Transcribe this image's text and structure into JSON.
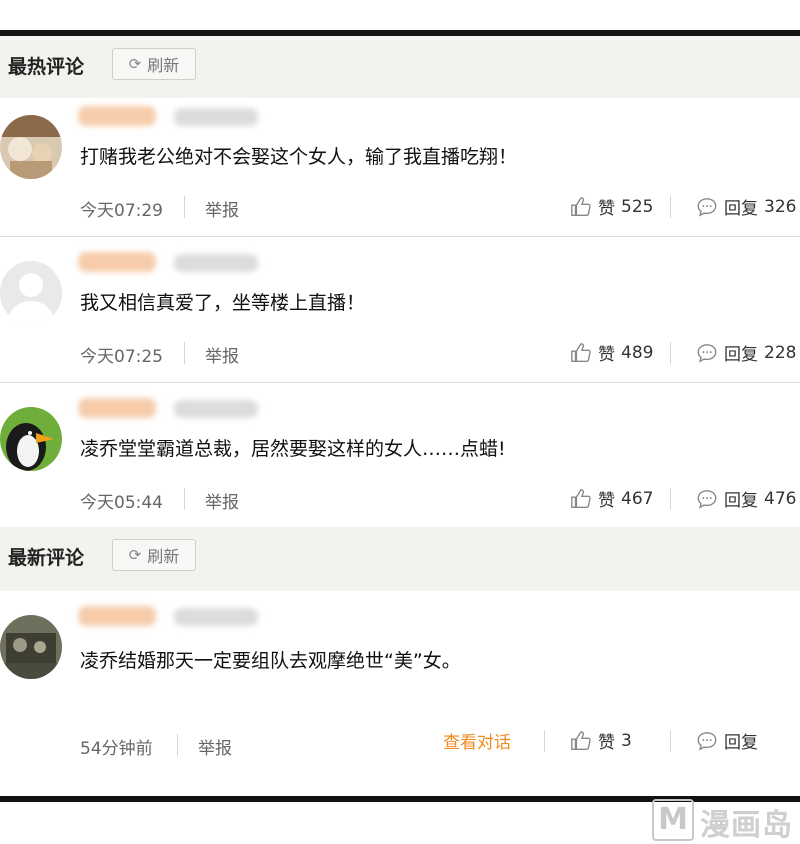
{
  "hot_section": {
    "title": "最热评论",
    "refresh_label": "刷新"
  },
  "new_section": {
    "title": "最新评论",
    "refresh_label": "刷新"
  },
  "hot_comments": [
    {
      "text": "打赌我老公绝对不会娶这个女人，输了我直播吃翔！",
      "time": "今天07:29",
      "report": "举报",
      "like_label": "赞",
      "like_count": "525",
      "reply_label": "回复",
      "reply_count": "326",
      "avatar_icon": "photo-avatar"
    },
    {
      "text": "我又相信真爱了，坐等楼上直播！",
      "time": "今天07:25",
      "report": "举报",
      "like_label": "赞",
      "like_count": "489",
      "reply_label": "回复",
      "reply_count": "228",
      "avatar_icon": "default-user-avatar"
    },
    {
      "text": "凌乔堂堂霸道总裁，居然要娶这样的女人……点蜡!",
      "time": "今天05:44",
      "report": "举报",
      "like_label": "赞",
      "like_count": "467",
      "reply_label": "回复",
      "reply_count": "476",
      "avatar_icon": "penguin-avatar"
    }
  ],
  "new_comments": [
    {
      "text": "凌乔结婚那天一定要组队去观摩绝世“美”女。",
      "time": "54分钟前",
      "report": "举报",
      "view_conversation": "查看对话",
      "like_label": "赞",
      "like_count": "3",
      "reply_label": "回复",
      "avatar_icon": "photo-avatar"
    }
  ],
  "watermark": {
    "logo": "M",
    "text": "漫画岛"
  },
  "icons": {
    "like": "thumbs-up-icon",
    "reply": "speech-bubble-icon",
    "refresh": "refresh-icon"
  },
  "colors": {
    "accent_orange": "#f08a1c",
    "header_bg": "#f2f2ef"
  }
}
